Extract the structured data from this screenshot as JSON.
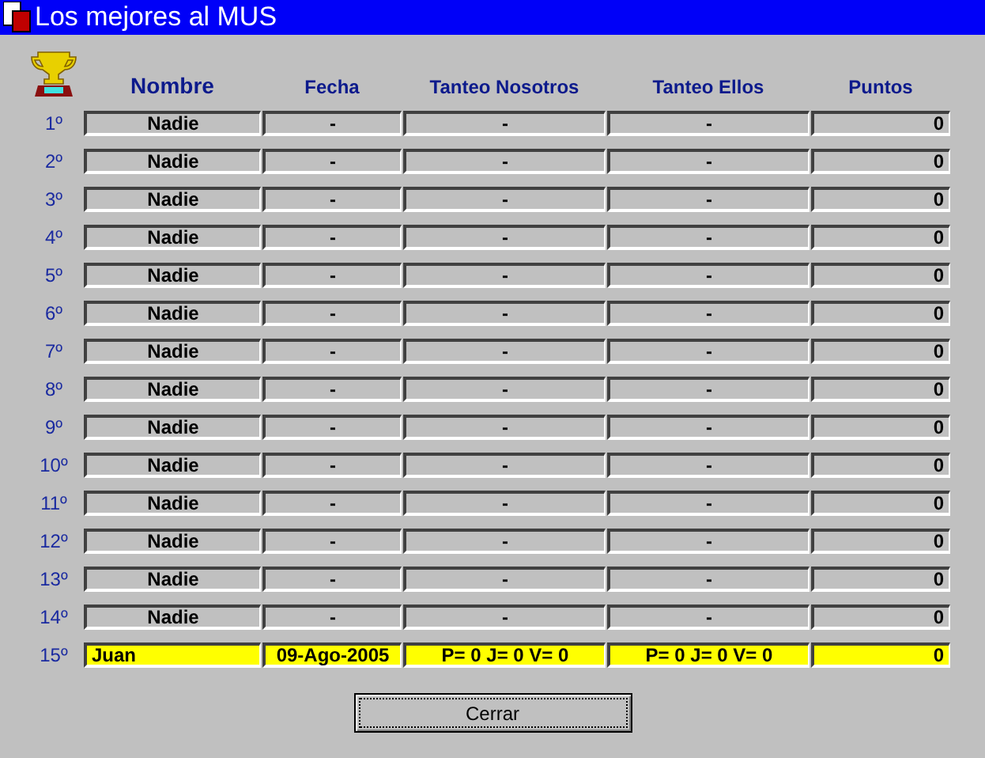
{
  "window": {
    "title": "Los mejores al MUS"
  },
  "columns": [
    "Nombre",
    "Fecha",
    "Tanteo Nosotros",
    "Tanteo Ellos",
    "Puntos"
  ],
  "rows": [
    {
      "rank": "1º",
      "name": "Nadie",
      "date": "-",
      "score_us": "-",
      "score_them": "-",
      "points": "0",
      "selected": false
    },
    {
      "rank": "2º",
      "name": "Nadie",
      "date": "-",
      "score_us": "-",
      "score_them": "-",
      "points": "0",
      "selected": false
    },
    {
      "rank": "3º",
      "name": "Nadie",
      "date": "-",
      "score_us": "-",
      "score_them": "-",
      "points": "0",
      "selected": false
    },
    {
      "rank": "4º",
      "name": "Nadie",
      "date": "-",
      "score_us": "-",
      "score_them": "-",
      "points": "0",
      "selected": false
    },
    {
      "rank": "5º",
      "name": "Nadie",
      "date": "-",
      "score_us": "-",
      "score_them": "-",
      "points": "0",
      "selected": false
    },
    {
      "rank": "6º",
      "name": "Nadie",
      "date": "-",
      "score_us": "-",
      "score_them": "-",
      "points": "0",
      "selected": false
    },
    {
      "rank": "7º",
      "name": "Nadie",
      "date": "-",
      "score_us": "-",
      "score_them": "-",
      "points": "0",
      "selected": false
    },
    {
      "rank": "8º",
      "name": "Nadie",
      "date": "-",
      "score_us": "-",
      "score_them": "-",
      "points": "0",
      "selected": false
    },
    {
      "rank": "9º",
      "name": "Nadie",
      "date": "-",
      "score_us": "-",
      "score_them": "-",
      "points": "0",
      "selected": false
    },
    {
      "rank": "10º",
      "name": "Nadie",
      "date": "-",
      "score_us": "-",
      "score_them": "-",
      "points": "0",
      "selected": false
    },
    {
      "rank": "11º",
      "name": "Nadie",
      "date": "-",
      "score_us": "-",
      "score_them": "-",
      "points": "0",
      "selected": false
    },
    {
      "rank": "12º",
      "name": "Nadie",
      "date": "-",
      "score_us": "-",
      "score_them": "-",
      "points": "0",
      "selected": false
    },
    {
      "rank": "13º",
      "name": "Nadie",
      "date": "-",
      "score_us": "-",
      "score_them": "-",
      "points": "0",
      "selected": false
    },
    {
      "rank": "14º",
      "name": "Nadie",
      "date": "-",
      "score_us": "-",
      "score_them": "-",
      "points": "0",
      "selected": false
    },
    {
      "rank": "15º",
      "name": "Juan",
      "date": "09-Ago-2005",
      "score_us": "P= 0  J= 0  V= 0",
      "score_them": "P= 0  J= 0  V= 0",
      "points": "0",
      "selected": true
    }
  ],
  "buttons": [
    "Cerrar"
  ]
}
